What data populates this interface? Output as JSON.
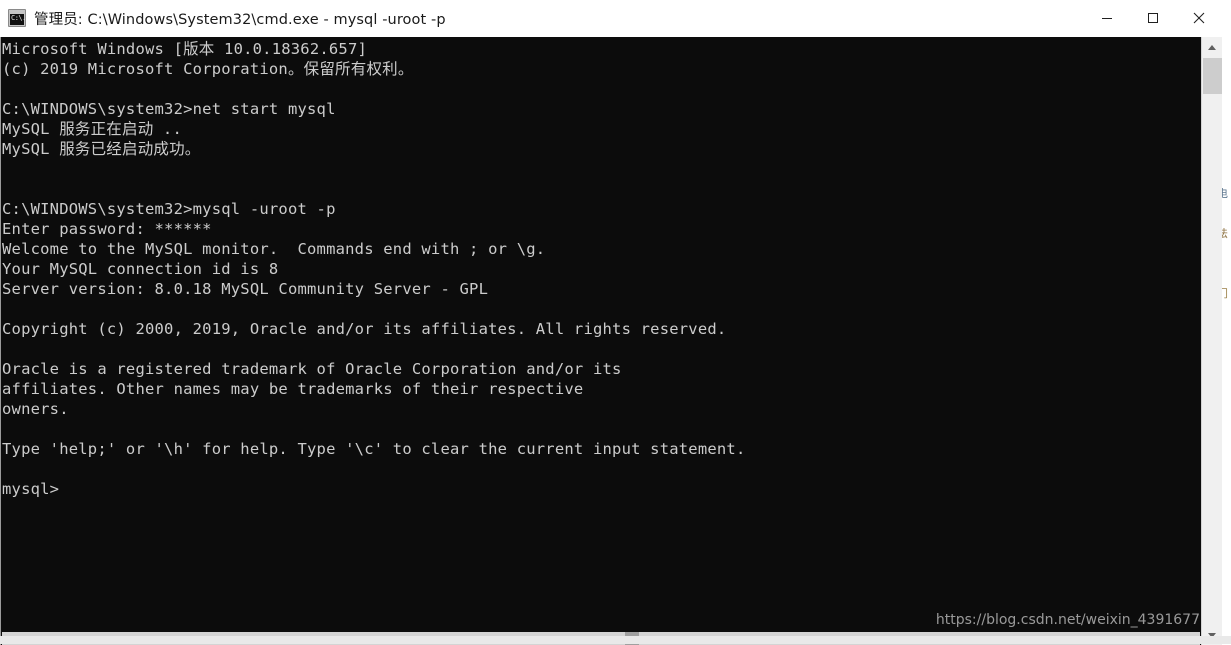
{
  "window": {
    "title": "管理员: C:\\Windows\\System32\\cmd.exe - mysql  -uroot -p",
    "icon": "cmd-console-icon",
    "controls": {
      "minimize_label": "—",
      "maximize_label": "□",
      "close_label": "✕"
    },
    "colors": {
      "titlebar_bg": "#ffffff",
      "titlebar_text": "#1a1a1a",
      "console_bg": "#0c0c0c",
      "console_text": "#cccccc",
      "scrollbar_track": "#f0f0f0",
      "scrollbar_thumb": "#cdcdcd"
    }
  },
  "console": {
    "lines": [
      "Microsoft Windows [版本 10.0.18362.657]",
      "(c) 2019 Microsoft Corporation。保留所有权利。",
      "",
      "C:\\WINDOWS\\system32>net start mysql",
      "MySQL 服务正在启动 ..",
      "MySQL 服务已经启动成功。",
      "",
      "",
      "C:\\WINDOWS\\system32>mysql -uroot -p",
      "Enter password: ******",
      "Welcome to the MySQL monitor.  Commands end with ; or \\g.",
      "Your MySQL connection id is 8",
      "Server version: 8.0.18 MySQL Community Server - GPL",
      "",
      "Copyright (c) 2000, 2019, Oracle and/or its affiliates. All rights reserved.",
      "",
      "Oracle is a registered trademark of Oracle Corporation and/or its",
      "affiliates. Other names may be trademarks of their respective",
      "owners.",
      "",
      "Type 'help;' or '\\h' for help. Type '\\c' to clear the current input statement.",
      "",
      "mysql>"
    ]
  },
  "watermark": {
    "text": "https://blog.csdn.net/weixin_4391677"
  },
  "scrollbars": {
    "vertical": {
      "up_icon": "chevron-up-icon",
      "down_icon": "chevron-down-icon",
      "thumb_position_pct": 3,
      "thumb_size_pct": 6
    },
    "horizontal": {
      "thumb_position_pct": 51,
      "thumb_size_pct": 1
    }
  },
  "background": {
    "glyphs": [
      "、",
      "电",
      "法",
      "门"
    ]
  }
}
